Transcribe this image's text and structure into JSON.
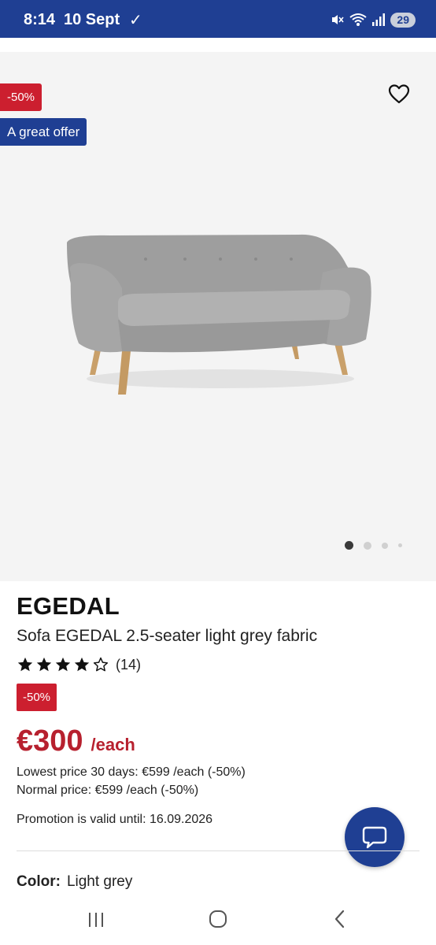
{
  "status_bar": {
    "time": "8:14",
    "date": "10 Sept",
    "battery": "29",
    "icons": [
      "download-done-icon",
      "mute-icon",
      "wifi-icon",
      "signal-icon",
      "battery-icon"
    ]
  },
  "product_image": {
    "discount_badge": "-50%",
    "offer_badge": "A great offer",
    "favorite_icon": "heart-icon",
    "carousel_pages": 4,
    "carousel_active": 1
  },
  "product": {
    "brand": "EGEDAL",
    "name": "Sofa EGEDAL 2.5-seater light grey fabric",
    "rating": 4,
    "rating_max": 5,
    "rating_count": "(14)",
    "discount_badge": "-50%",
    "price": "€300",
    "price_unit": "/each",
    "lowest_price": "Lowest price 30 days: €599 /each (-50%)",
    "normal_price": "Normal price: €599 /each (-50%)",
    "promotion": "Promotion is valid until: 16.09.2026",
    "color_label": "Color:",
    "color_value": "Light grey"
  },
  "colors": {
    "brand_blue": "#1f3f93",
    "sale_red": "#cc1f2f",
    "price_red": "#b7202e"
  },
  "nav": {
    "icons": [
      "recent-apps-icon",
      "home-icon",
      "back-icon"
    ]
  }
}
